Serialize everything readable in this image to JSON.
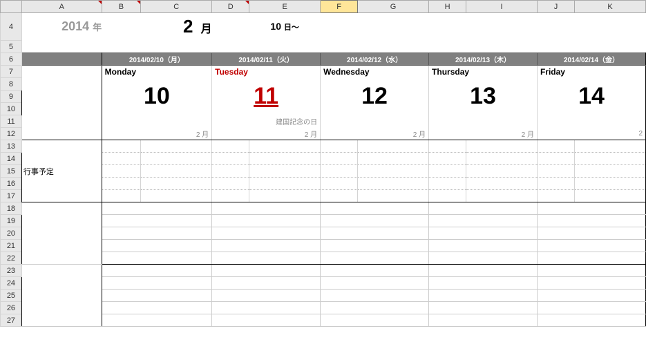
{
  "columns": [
    "A",
    "B",
    "C",
    "D",
    "E",
    "F",
    "G",
    "H",
    "I",
    "J",
    "K"
  ],
  "selected_column": "F",
  "row_numbers": [
    "4",
    "5",
    "6",
    "7",
    "8",
    "9",
    "10",
    "11",
    "12",
    "13",
    "14",
    "15",
    "16",
    "17",
    "18",
    "19",
    "20",
    "21",
    "22",
    "23",
    "24",
    "25",
    "26",
    "27"
  ],
  "title": {
    "year": "2014",
    "year_suffix": "年",
    "month": "2",
    "month_suffix": "月",
    "day_from": "10",
    "day_from_suffix": "日～"
  },
  "days": [
    {
      "date_header": "2014/02/10（月）",
      "weekday": "Monday",
      "num": "10",
      "holiday": false,
      "note": "",
      "month_tag": "2 月"
    },
    {
      "date_header": "2014/02/11（火）",
      "weekday": "Tuesday",
      "num": "11",
      "holiday": true,
      "note": "建国記念の日",
      "month_tag": "2 月"
    },
    {
      "date_header": "2014/02/12（水）",
      "weekday": "Wednesday",
      "num": "12",
      "holiday": false,
      "note": "",
      "month_tag": "2 月"
    },
    {
      "date_header": "2014/02/13（木）",
      "weekday": "Thursday",
      "num": "13",
      "holiday": false,
      "note": "",
      "month_tag": "2 月"
    },
    {
      "date_header": "2014/02/14（金）",
      "weekday": "Friday",
      "num": "14",
      "holiday": false,
      "note": "",
      "month_tag": "2"
    }
  ],
  "side_label": "行事予定"
}
